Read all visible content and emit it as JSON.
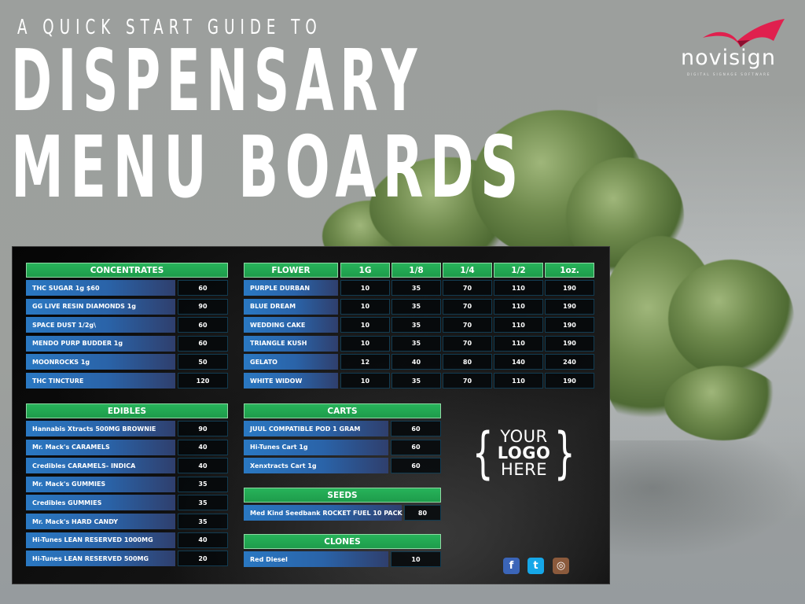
{
  "header": {
    "kicker": "A QUICK START GUIDE TO",
    "title_line1": "DISPENSARY",
    "title_line2": "MENU BOARDS"
  },
  "brand": {
    "name": "novisign",
    "tagline": "DIGITAL SIGNAGE SOFTWARE",
    "accent_color": "#e0204e"
  },
  "colors": {
    "section_header": "#1fa34f",
    "item_bar": "#2a6fb8",
    "price_cell": "#050505"
  },
  "menu": {
    "concentrates": {
      "title": "CONCENTRATES",
      "items": [
        {
          "name": "THC SUGAR 1g  $60",
          "price": "60"
        },
        {
          "name": "GG LIVE RESIN DIAMONDS  1g",
          "price": "90"
        },
        {
          "name": "SPACE DUST 1/2g\\",
          "price": "60"
        },
        {
          "name": "MENDO PURP BUDDER 1g",
          "price": "60"
        },
        {
          "name": "MOONROCKS 1g",
          "price": "50"
        },
        {
          "name": "THC TINCTURE",
          "price": "120"
        }
      ]
    },
    "flower": {
      "title": "FLOWER",
      "columns": [
        "1G",
        "1/8",
        "1/4",
        "1/2",
        "1oz."
      ],
      "items": [
        {
          "name": "PURPLE DURBAN",
          "prices": [
            "10",
            "35",
            "70",
            "110",
            "190"
          ]
        },
        {
          "name": "BLUE DREAM",
          "prices": [
            "10",
            "35",
            "70",
            "110",
            "190"
          ]
        },
        {
          "name": "WEDDING CAKE",
          "prices": [
            "10",
            "35",
            "70",
            "110",
            "190"
          ]
        },
        {
          "name": "TRIANGLE KUSH",
          "prices": [
            "10",
            "35",
            "70",
            "110",
            "190"
          ]
        },
        {
          "name": "GELATO",
          "prices": [
            "12",
            "40",
            "80",
            "140",
            "240"
          ]
        },
        {
          "name": "WHITE WIDOW",
          "prices": [
            "10",
            "35",
            "70",
            "110",
            "190"
          ]
        }
      ]
    },
    "edibles": {
      "title": "EDIBLES",
      "items": [
        {
          "name": "Hannabis Xtracts  500MG BROWNIE",
          "price": "90"
        },
        {
          "name": "Mr. Mack's  CARAMELS",
          "price": "40"
        },
        {
          "name": "Credibles CARAMELS- INDICA",
          "price": "40"
        },
        {
          "name": "Mr. Mack's GUMMIES",
          "price": "35"
        },
        {
          "name": "Credibles GUMMIES",
          "price": "35"
        },
        {
          "name": "Mr. Mack's HARD CANDY",
          "price": "35"
        },
        {
          "name": "Hi-Tunes  LEAN RESERVED 1000MG",
          "price": "40"
        },
        {
          "name": "Hi-Tunes  LEAN RESERVED 500MG",
          "price": "20"
        }
      ]
    },
    "carts": {
      "title": "CARTS",
      "items": [
        {
          "name": "JUUL COMPATIBLE POD 1 GRAM",
          "price": "60"
        },
        {
          "name": "Hi-Tunes Cart 1g",
          "price": "60"
        },
        {
          "name": "Xenxtracts Cart 1g",
          "price": "60"
        }
      ]
    },
    "seeds": {
      "title": "SEEDS",
      "items": [
        {
          "name": "Med Kind Seedbank ROCKET FUEL 10 PACK",
          "price": "80"
        }
      ]
    },
    "clones": {
      "title": "CLONES",
      "items": [
        {
          "name": "Red Diesel",
          "price": "10"
        }
      ]
    }
  },
  "logo_placeholder": {
    "line1": "YOUR",
    "line2": "LOGO",
    "line3": "HERE",
    "brace_open": "{",
    "brace_close": "}"
  },
  "social": [
    {
      "icon": "facebook-icon",
      "glyph": "f"
    },
    {
      "icon": "twitter-icon",
      "glyph": "t"
    },
    {
      "icon": "instagram-icon",
      "glyph": "◎"
    }
  ]
}
